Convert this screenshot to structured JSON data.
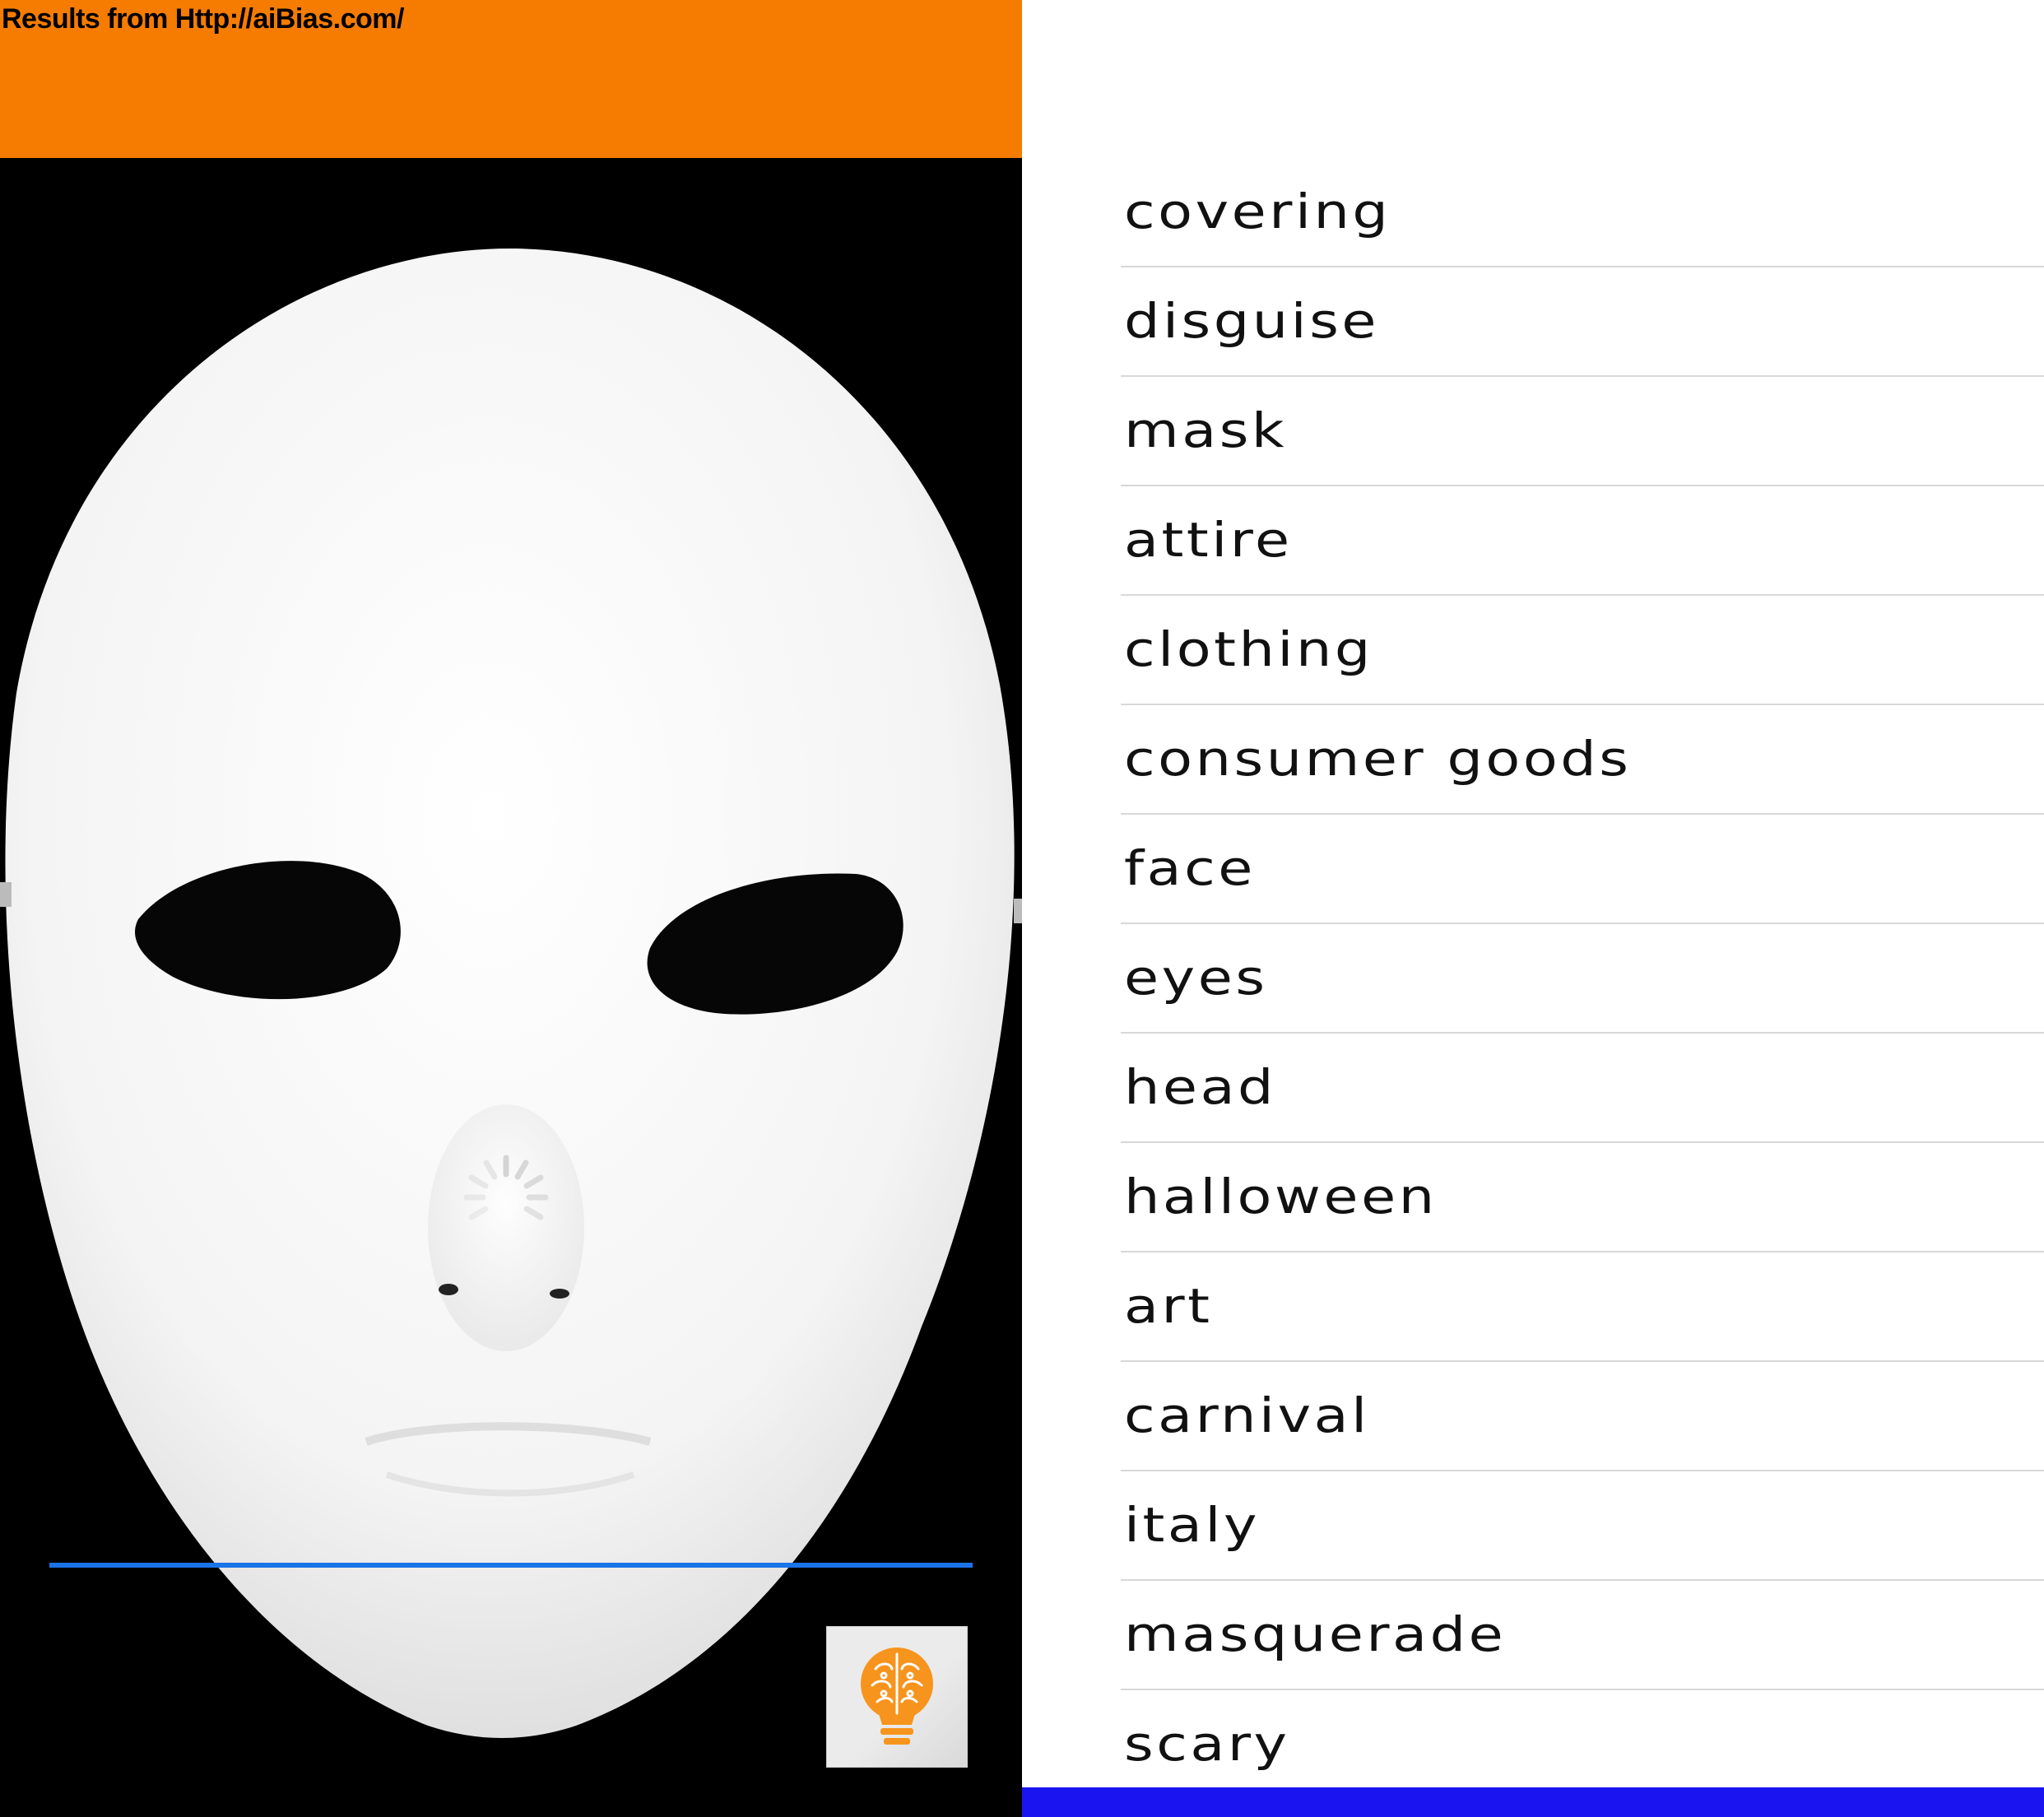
{
  "header": {
    "text": "Results from Http://aiBias.com/"
  },
  "tags": [
    "covering",
    "disguise",
    "mask",
    "attire",
    "clothing",
    "consumer goods",
    "face",
    "eyes",
    "head",
    "halloween",
    "art",
    "carnival",
    "italy",
    "masquerade",
    "scary"
  ],
  "colors": {
    "header_orange": "#f57c00",
    "progress_blue": "#1a73e8",
    "bottom_bar_blue": "#1a14f0",
    "logo_orange": "#f7941d"
  },
  "icons": {
    "logo": "brain-lightbulb-icon",
    "loading": "spinner-icon"
  }
}
